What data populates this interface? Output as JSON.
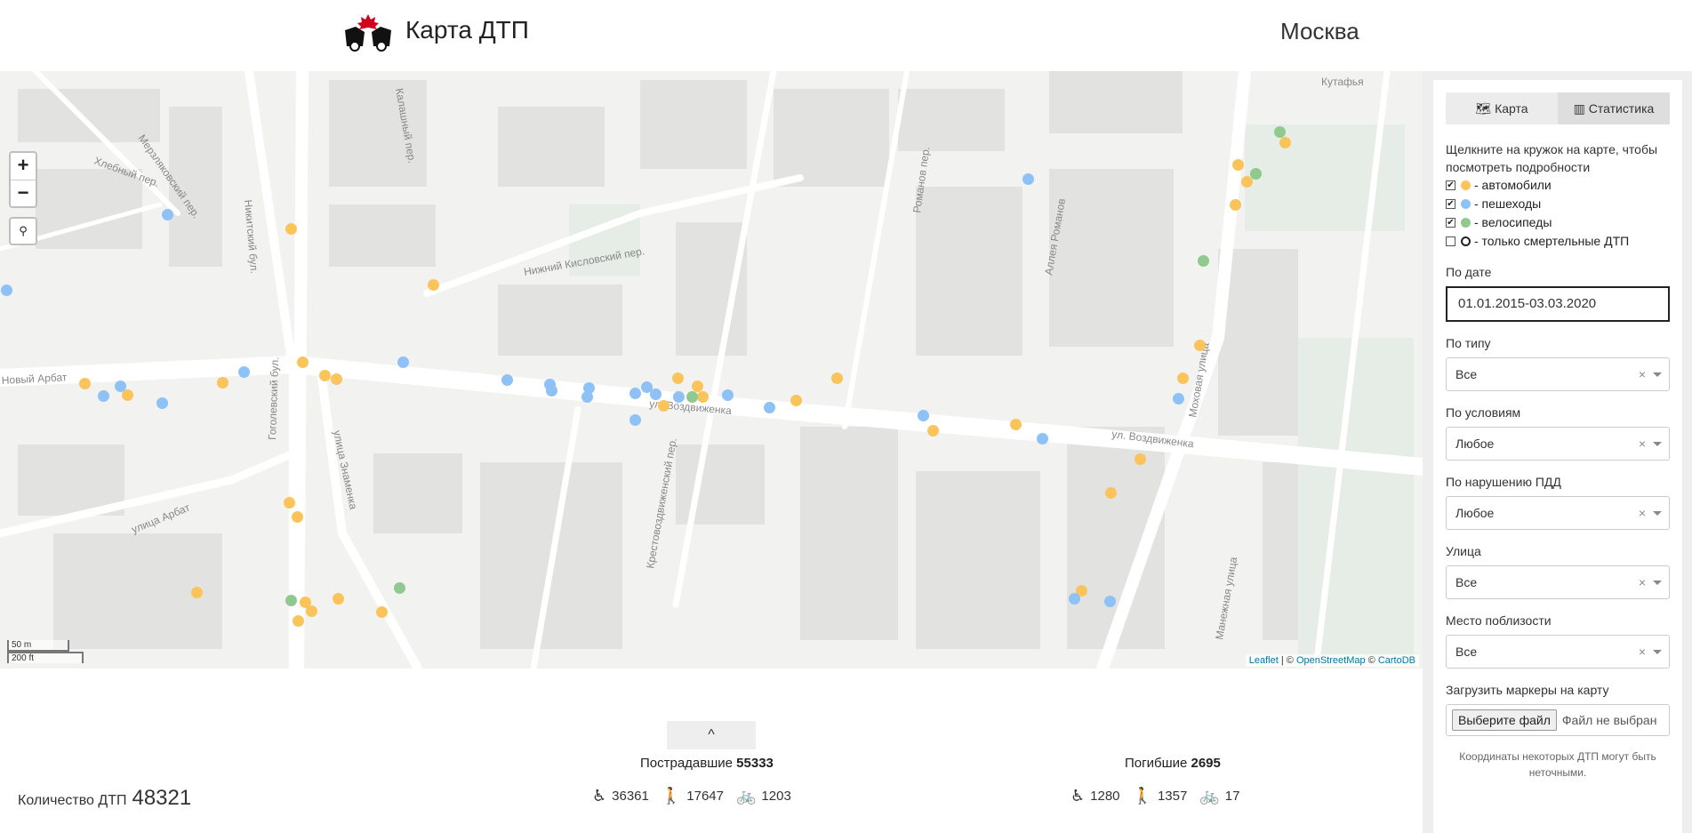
{
  "header": {
    "title": "Карта ДТП",
    "city": "Москва"
  },
  "map": {
    "zoom_in": "+",
    "zoom_out": "−",
    "scale_m": "50 m",
    "scale_ft": "200 ft",
    "attribution": {
      "leaflet": "Leaflet",
      "sep1": " | © ",
      "osm": "OpenStreetMap",
      "sep2": " © ",
      "carto": "CartoDB"
    },
    "street_labels": [
      "Новый Арбат",
      "ул. Воздвиженка",
      "ул. Воздвиженка",
      "Моховая улица",
      "улица Знаменка",
      "улица Арбат",
      "Гоголевский бул.",
      "Никитский бул.",
      "Нижний Кисловский пер.",
      "Хлебный пер.",
      "Романов пер.",
      "Крестовоздвиженский пер.",
      "Манежная улица",
      "Калашный пер.",
      "Мерзляковский пер.",
      "Аллея Романов",
      "Кутафья"
    ]
  },
  "panel": {
    "tab_map": "Карта",
    "tab_stats": "Статистика",
    "hint": "Щелкните на кружок на карте, чтобы посмотреть подробности",
    "legend": [
      {
        "checked": true,
        "color": "#fbc45a",
        "label": " - автомобили"
      },
      {
        "checked": true,
        "color": "#8ec1f5",
        "label": " - пешеходы"
      },
      {
        "checked": true,
        "color": "#8fc98f",
        "label": " - велосипеды"
      },
      {
        "checked": false,
        "color": "ring",
        "label": " - только смертельные ДТП"
      }
    ],
    "date_label": "По дате",
    "date_value": "01.01.2015-03.03.2020",
    "type_label": "По типу",
    "type_value": "Все",
    "cond_label": "По условиям",
    "cond_value": "Любое",
    "viol_label": "По нарушению ПДД",
    "viol_value": "Любое",
    "street_label": "Улица",
    "street_value": "Все",
    "near_label": "Место поблизости",
    "near_value": "Все",
    "upload_label": "Загрузить маркеры на карту",
    "file_button": "Выберите файл",
    "file_status": "Файл не выбран",
    "note": "Координаты некоторых ДТП могут быть неточными."
  },
  "stats": {
    "toggle": "^",
    "total_label": "Количество ДТП",
    "total_value": "48321",
    "injured_label": "Пострадавшие",
    "injured_value": "55333",
    "injured_drivers": "36361",
    "injured_peds": "17647",
    "injured_bikes": "1203",
    "dead_label": "Погибшие",
    "dead_value": "2695",
    "dead_drivers": "1280",
    "dead_peds": "1357",
    "dead_bikes": "17"
  }
}
